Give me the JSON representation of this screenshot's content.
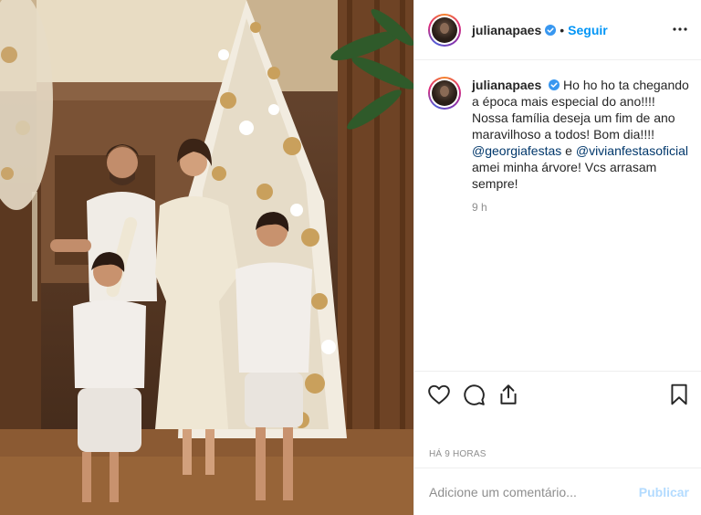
{
  "post": {
    "username": "julianapaes",
    "follow_label": "Seguir",
    "separator": "•",
    "caption_username": "julianapaes",
    "caption_part1": "Ho ho ho ta chegando a época mais especial do ano!!!! Nossa família deseja um fim de ano maravilhoso a todos! Bom dia!!!!",
    "mention1": "@georgiafestas",
    "connector": "e",
    "mention2": "@vivianfestasoficial",
    "caption_part2": "amei minha árvore! Vcs arrasam sempre!",
    "relative_time": "9 h",
    "date_label": "HÁ 9 HORAS"
  },
  "comment": {
    "placeholder": "Adicione um comentário...",
    "publish_label": "Publicar"
  },
  "icons": {
    "verified": "verified-badge-icon",
    "more": "more-options-icon",
    "like": "heart-icon",
    "comment": "comment-icon",
    "share": "share-icon",
    "save": "bookmark-icon"
  },
  "colors": {
    "accent": "#0095f6",
    "publish_disabled": "#b3dbff",
    "mention": "#00376b",
    "muted": "#8e8e8e"
  }
}
